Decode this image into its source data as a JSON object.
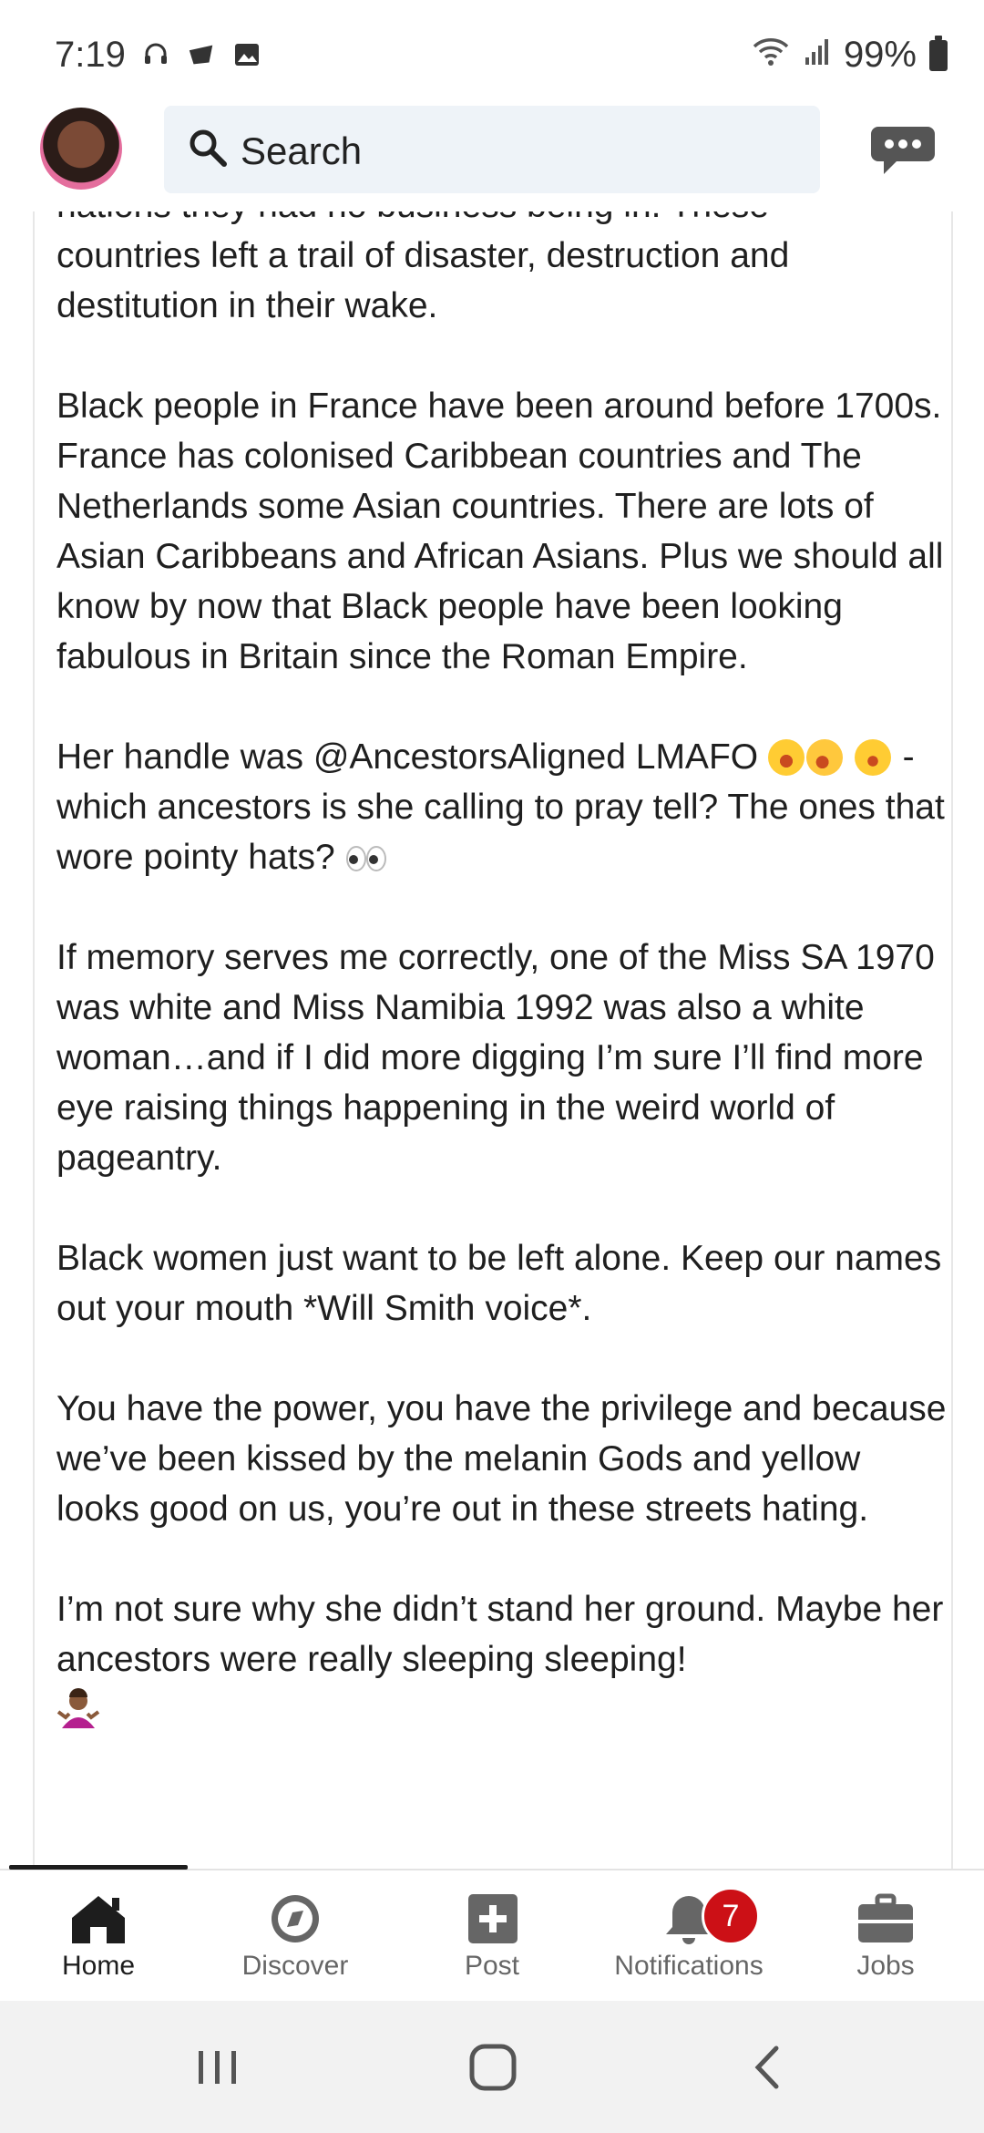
{
  "status_bar": {
    "time": "7:19",
    "battery": "99%"
  },
  "header": {
    "search_placeholder": "Search"
  },
  "post": {
    "cut_line": "nations they had no business being in. These",
    "paragraphs": [
      "countries left a trail of disaster, destruction and destitution in their wake.",
      "Black people in France have been around before 1700s. France has colonised Caribbean countries and The Netherlands some Asian countries. There are lots of Asian Caribbeans and African Asians. Plus we should all know by now that Black people have been looking fabulous in Britain since the Roman Empire.",
      "Her handle was @AncestorsAligned LMAFO",
      "- which ancestors is she calling to pray tell? The ones that wore pointy hats?",
      "If memory serves me correctly, one of the Miss SA 1970 was white and Miss Namibia 1992 was also a white woman…and if I did more digging I’m sure I’ll find more eye raising things happening in the weird world of pageantry.",
      "Black women just want to be left alone. Keep our names out your mouth *Will Smith voice*.",
      "You have the power, you have the privilege and because we’ve been kissed by the melanin Gods and yellow looks good on us, you’re out in these streets hating.",
      "I’m not sure why she didn’t stand her ground. Maybe her ancestors were really sleeping sleeping!"
    ]
  },
  "nav": {
    "items": [
      {
        "label": "Home",
        "icon": "home-icon"
      },
      {
        "label": "Discover",
        "icon": "compass-icon"
      },
      {
        "label": "Post",
        "icon": "plus-square-icon"
      },
      {
        "label": "Notifications",
        "icon": "bell-icon",
        "badge": "7"
      },
      {
        "label": "Jobs",
        "icon": "briefcase-icon"
      }
    ]
  },
  "colors": {
    "badge": "#cc1016",
    "search_bg": "#eef3f8",
    "nav_active": "#1d1d1d"
  }
}
